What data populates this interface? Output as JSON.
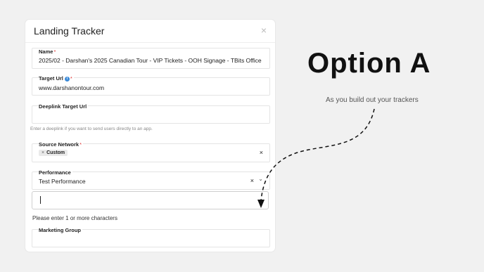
{
  "modal": {
    "title": "Landing Tracker",
    "close": "×"
  },
  "fields": {
    "name": {
      "label": "Name",
      "required": "*",
      "value": "2025/02 - Darshan's 2025 Canadian Tour - VIP Tickets - OOH Signage - TBits Office"
    },
    "target_url": {
      "label": "Target Url",
      "info": "i",
      "required": "*",
      "value": "www.darshanontour.com"
    },
    "deeplink": {
      "label": "Deeplink Target Url",
      "value": "",
      "hint": "Enter a deeplink if you want to send users directly to an app."
    },
    "source_network": {
      "label": "Source Network",
      "required": "*",
      "chip_remove": "×",
      "chip": "Custom",
      "clear": "×"
    },
    "performance": {
      "label": "Performance",
      "value": "Test Performance",
      "clear": "×",
      "chevron": "⌄"
    },
    "search": {
      "message": "Please enter 1 or more characters"
    },
    "marketing_group": {
      "label": "Marketing Group"
    }
  },
  "annotation": {
    "heading": "Option A",
    "subtitle": "As you build out your trackers"
  }
}
